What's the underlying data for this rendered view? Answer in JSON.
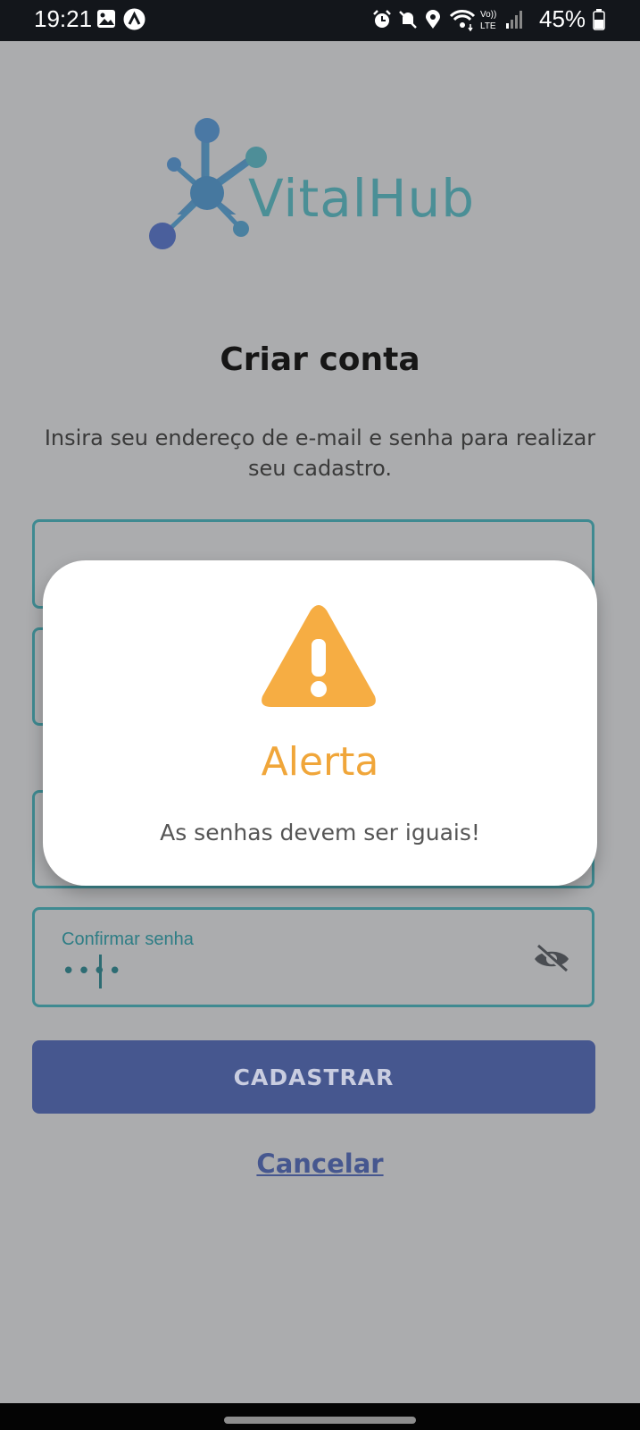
{
  "status_bar": {
    "time": "19:21",
    "battery": "45%",
    "icons": [
      "image-icon",
      "app-notification-icon",
      "alarm-icon",
      "mute-icon",
      "location-icon",
      "wifi-icon",
      "volte-icon",
      "signal-icon",
      "battery-icon"
    ]
  },
  "logo": {
    "text": "VitalHub"
  },
  "header": {
    "title": "Criar conta",
    "subtitle": "Insira seu endereço de e-mail e senha para realizar seu cadastro."
  },
  "form": {
    "confirm_label": "Confirmar senha",
    "confirm_value": "••••"
  },
  "buttons": {
    "register": "CADASTRAR",
    "cancel": "Cancelar"
  },
  "alert": {
    "title": "Alerta",
    "message": "As senhas devem ser iguais!"
  },
  "colors": {
    "overlay": "#abacae",
    "accent": "#3f8a91",
    "button": "#46578f",
    "warning": "#f0a63a"
  }
}
